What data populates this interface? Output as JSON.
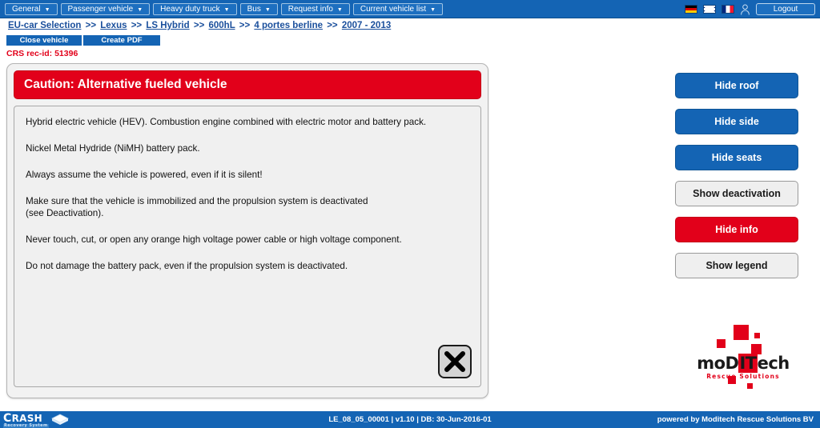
{
  "menubar": {
    "items": [
      {
        "label": "General",
        "caret": "▼"
      },
      {
        "label": "Passenger vehicle",
        "caret": "▼"
      },
      {
        "label": "Heavy duty truck",
        "caret": "▼"
      },
      {
        "label": "Bus",
        "caret": "▼"
      },
      {
        "label": "Request info",
        "caret": "▼"
      },
      {
        "label": "Current vehicle list",
        "caret": "▼"
      }
    ],
    "flags": [
      {
        "name": "german-flag",
        "title": "Deutsch"
      },
      {
        "name": "uk-flag",
        "title": "English"
      },
      {
        "name": "french-flag",
        "title": "Français"
      }
    ],
    "user_icon": "user-icon",
    "logout_label": "Logout"
  },
  "breadcrumb": {
    "separator": ">>",
    "items": [
      "EU-car Selection",
      "Lexus",
      "LS Hybrid",
      "600hL",
      "4 portes berline",
      "2007 - 2013"
    ]
  },
  "actions": {
    "close_vehicle_label": "Close vehicle",
    "create_pdf_label": "Create PDF",
    "rec_id": "CRS rec-id: 51396"
  },
  "panel": {
    "caution_title": "Caution: Alternative fueled vehicle",
    "paragraphs": [
      "Hybrid electric vehicle (HEV). Combustion engine combined with electric motor and battery pack.",
      "Nickel Metal Hydride (NiMH) battery pack.",
      "Always assume the vehicle is powered, even if it is silent!",
      "Make sure that the vehicle is immobilized and the propulsion system is deactivated\n(see Deactivation).",
      "Never touch, cut, or open any orange high voltage power cable or high voltage component.",
      "Do not damage the battery pack, even if the propulsion system is deactivated."
    ],
    "close_icon": "close-x-icon"
  },
  "side_buttons": [
    {
      "label": "Hide roof",
      "style": "blue"
    },
    {
      "label": "Hide side",
      "style": "blue"
    },
    {
      "label": "Hide seats",
      "style": "blue"
    },
    {
      "label": "Show deactivation",
      "style": "grey"
    },
    {
      "label": "Hide info",
      "style": "red"
    },
    {
      "label": "Show legend",
      "style": "grey"
    }
  ],
  "logo": {
    "word_part1": "moD",
    "word_highlight": "IT",
    "word_part2": "ech",
    "tagline": "Rescue Solutions"
  },
  "footer": {
    "brand_main_c": "C",
    "brand_main_rest": "RASH",
    "brand_sub": "Recovery System",
    "center_text": "LE_08_05_00001 | v1.10 | DB: 30-Jun-2016-01",
    "right_text": "powered by Moditech Rescue Solutions BV"
  },
  "colors": {
    "brand_blue": "#1464b4",
    "alert_red": "#e2001a",
    "panel_grey": "#f0f0f0"
  }
}
